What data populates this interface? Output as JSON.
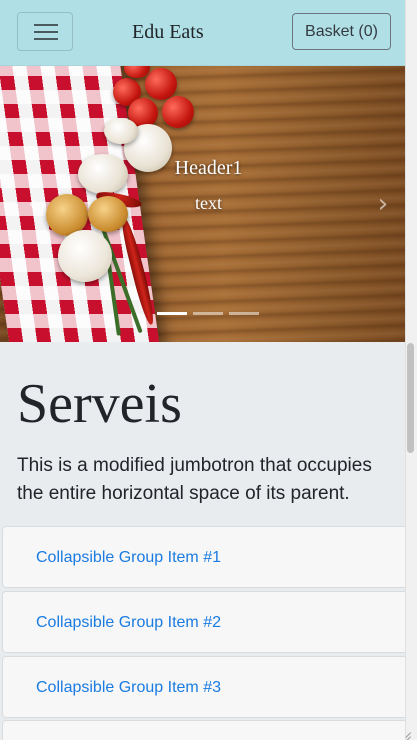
{
  "navbar": {
    "brand": "Edu Eats",
    "toggler_icon": "hamburger-menu-icon",
    "basket_label": "Basket (0)"
  },
  "carousel": {
    "slides": [
      {
        "title": "Header1",
        "text": "text"
      }
    ],
    "active_index": 0,
    "indicator_count": 3,
    "prev_icon": "chevron-left-icon",
    "next_icon": "chevron-right-icon"
  },
  "jumbotron": {
    "title": "Serveis",
    "lead": "This is a modified jumbotron that occupies the entire horizontal space of its parent."
  },
  "accordion": {
    "items": [
      {
        "label": "Collapsible Group Item #1"
      },
      {
        "label": "Collapsible Group Item #2"
      },
      {
        "label": "Collapsible Group Item #3"
      },
      {
        "label": ""
      }
    ]
  },
  "colors": {
    "navbar_bg": "#b0e0e6",
    "link": "#1a7be0",
    "page_bg": "#e9ecef"
  }
}
